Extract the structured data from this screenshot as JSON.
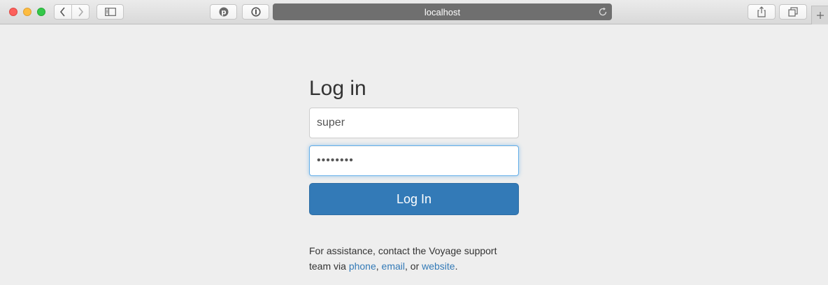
{
  "browser": {
    "address": "localhost",
    "colors": {
      "address_bar": "#6f6f6f",
      "close": "#fc605c",
      "minimize": "#fdbc40",
      "maximize": "#34c84a"
    },
    "icons": [
      "back-icon",
      "forward-icon",
      "sidebar-icon",
      "pinterest-icon",
      "password-icon",
      "reload-icon",
      "share-icon",
      "tabs-icon",
      "plus-icon"
    ]
  },
  "login": {
    "title": "Log in",
    "username_value": "super",
    "password_value": "••••••••",
    "submit_label": "Log In",
    "colors": {
      "primary": "#337ab7",
      "focus": "#66afe9"
    }
  },
  "assistance": {
    "text_before": "For assistance, contact the Voyage support team via ",
    "phone_label": "phone",
    "sep1": ", ",
    "email_label": "email",
    "sep2": ", or ",
    "website_label": "website",
    "end": "."
  }
}
